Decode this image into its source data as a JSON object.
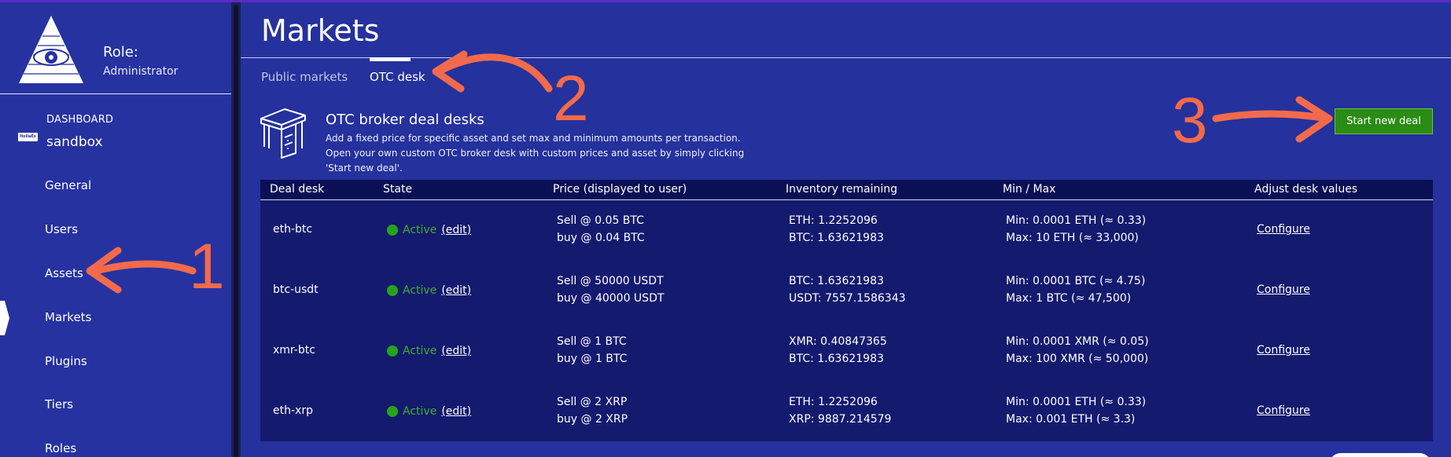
{
  "sidebar": {
    "role_title": "Role:",
    "role_value": "Administrator",
    "dashboard_label": "DASHBOARD",
    "exchange_badge": "HollaEx",
    "exchange_name": "sandbox",
    "items": [
      {
        "label": "General",
        "icon": "none"
      },
      {
        "label": "Users",
        "icon": "none"
      },
      {
        "label": "Assets",
        "icon": "none"
      },
      {
        "label": "Markets",
        "icon": "none",
        "active": true
      },
      {
        "label": "Plugins",
        "icon": "none"
      },
      {
        "label": "Tiers",
        "icon": "none"
      },
      {
        "label": "Roles",
        "icon": "none"
      }
    ]
  },
  "main": {
    "title": "Markets",
    "tabs": [
      {
        "label": "Public markets",
        "active": false
      },
      {
        "label": "OTC desk",
        "active": true
      }
    ],
    "otc": {
      "heading": "OTC broker deal desks",
      "description": "Add a fixed price for specific asset and set max and minimum amounts per transaction. Open your own custom OTC broker desk with custom prices and asset by simply clicking 'Start new deal'.",
      "start_button": "Start new deal"
    },
    "table": {
      "headers": [
        "Deal desk",
        "State",
        "Price (displayed to user)",
        "Inventory remaining",
        "Min / Max",
        "Adjust desk values"
      ],
      "rows": [
        {
          "desk": "eth-btc",
          "state": "Active",
          "edit": "(edit)",
          "price_sell": "Sell @ 0.05 BTC",
          "price_buy": "buy @ 0.04 BTC",
          "inv_1": "ETH: 1.2252096",
          "inv_2": "BTC: 1.63621983",
          "min": "Min: 0.0001 ETH  (≈ 0.33)",
          "max": "Max: 10 ETH  (≈ 33,000)",
          "configure": "Configure"
        },
        {
          "desk": "btc-usdt",
          "state": "Active",
          "edit": "(edit)",
          "price_sell": "Sell @ 50000 USDT",
          "price_buy": "buy @ 40000 USDT",
          "inv_1": "BTC: 1.63621983",
          "inv_2": "USDT: 7557.1586343",
          "min": "Min: 0.0001 BTC  (≈ 4.75)",
          "max": "Max: 1 BTC  (≈ 47,500)",
          "configure": "Configure"
        },
        {
          "desk": "xmr-btc",
          "state": "Active",
          "edit": "(edit)",
          "price_sell": "Sell @ 1 BTC",
          "price_buy": "buy @ 1 BTC",
          "inv_1": "XMR: 0.40847365",
          "inv_2": "BTC: 1.63621983",
          "min": "Min: 0.0001 XMR  (≈ 0.05)",
          "max": "Max: 100 XMR  (≈ 50,000)",
          "configure": "Configure"
        },
        {
          "desk": "eth-xrp",
          "state": "Active",
          "edit": "(edit)",
          "price_sell": "Sell @ 2 XRP",
          "price_buy": "buy @ 2 XRP",
          "inv_1": "ETH: 1.2252096",
          "inv_2": "XRP: 9887.214579",
          "min": "Min: 0.0001 ETH  (≈ 0.33)",
          "max": "Max: 0.001 ETH  (≈ 3.3)",
          "configure": "Configure"
        }
      ]
    }
  },
  "annotations": [
    "1",
    "2",
    "3"
  ],
  "colors": {
    "background": "#25319c",
    "table_bg": "#141a6e",
    "table_header": "#0b0f55",
    "accent_green": "#2a8c14",
    "annotation": "#f26a4b"
  }
}
